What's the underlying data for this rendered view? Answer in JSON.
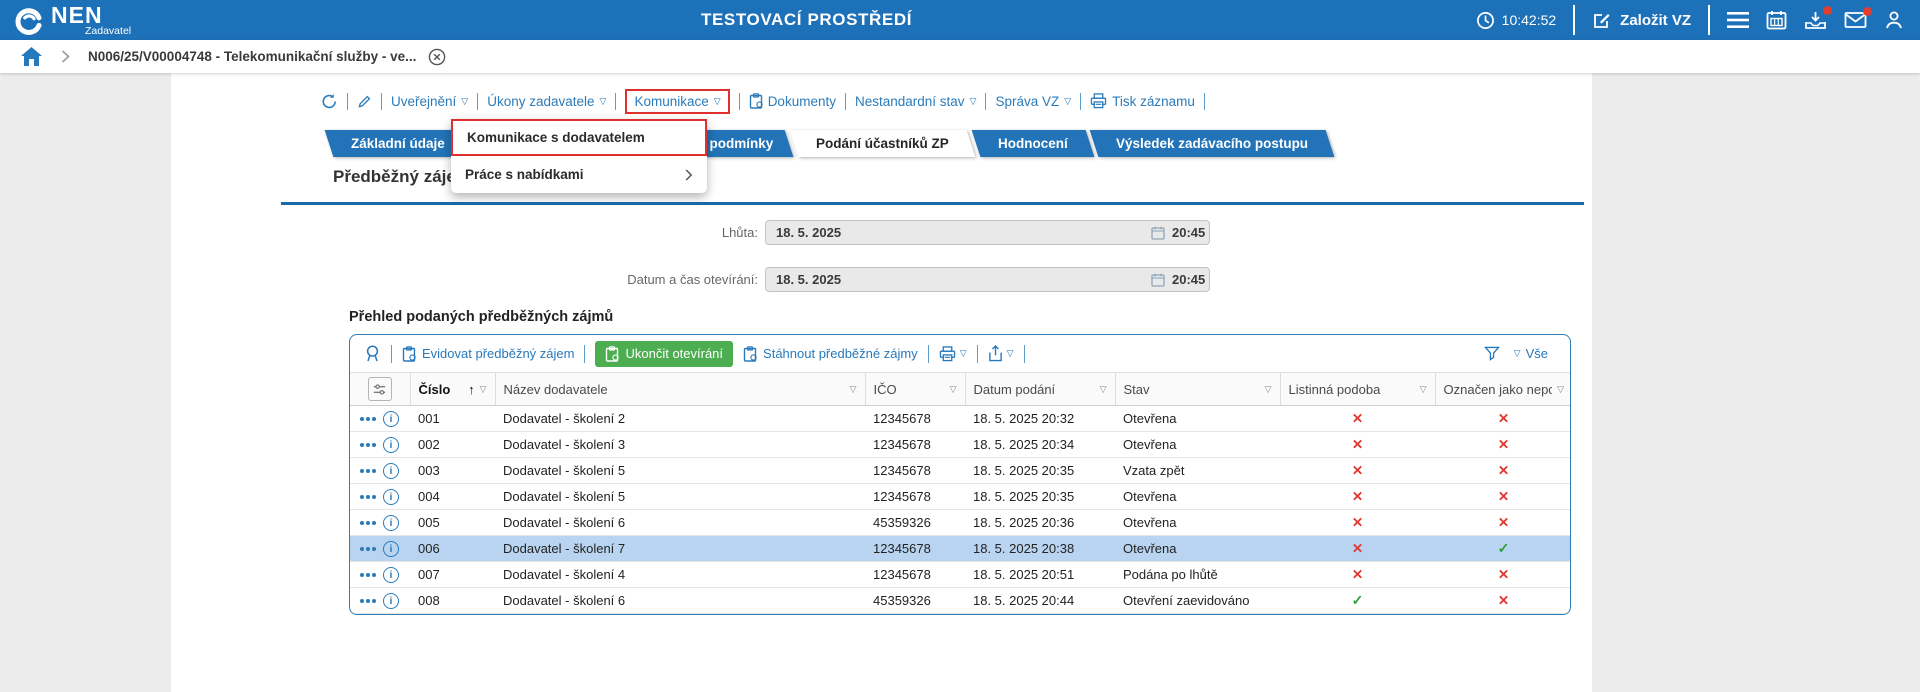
{
  "colors": {
    "header_blue": "#1d71b8",
    "link_blue": "#2779bd",
    "tab_blue": "#2273b8",
    "green": "#4cae50",
    "red_mark": "#e03a34",
    "green_mark": "#2f9e3f",
    "highlight_red": "#e0302e",
    "selected_row": "#b8d4f0"
  },
  "icons": {
    "caret_down": "▽",
    "sort_asc": "↑",
    "cross": "✕",
    "check": "✓"
  },
  "header": {
    "logo_title": "NEN",
    "logo_subtitle": "Zadavatel",
    "env_title": "TESTOVACÍ PROSTŘEDÍ",
    "time": "10:42:52",
    "create_vz_label": "Založit VZ"
  },
  "breadcrumb": {
    "item": "N006/25/V00004748 - Telekomunikační služby - ve..."
  },
  "record_toolbar": {
    "items": [
      {
        "label": "Uveřejnění",
        "caret": true,
        "icon": null,
        "highlighted": false
      },
      {
        "label": "Úkony zadavatele",
        "caret": true,
        "icon": null,
        "highlighted": false
      },
      {
        "label": "Komunikace",
        "caret": true,
        "icon": null,
        "highlighted": true
      },
      {
        "label": "Dokumenty",
        "caret": false,
        "icon": "clipboard",
        "highlighted": false
      },
      {
        "label": "Nestandardní stav",
        "caret": true,
        "icon": null,
        "highlighted": false
      },
      {
        "label": "Správa VZ",
        "caret": true,
        "icon": null,
        "highlighted": false
      },
      {
        "label": "Tisk záznamu",
        "caret": false,
        "icon": "printer",
        "highlighted": false
      }
    ]
  },
  "dropdown_menu": {
    "items": [
      {
        "label": "Komunikace s dodavatelem",
        "highlighted": true,
        "submenu": false
      },
      {
        "label": "Práce s nabídkami",
        "highlighted": false,
        "submenu": true
      }
    ]
  },
  "tabs": [
    {
      "label": "Základní údaje",
      "active": false,
      "wide": false
    },
    {
      "label": "Zadávací podmínky",
      "active": false,
      "wide": true
    },
    {
      "label": "Podání účastníků ZP",
      "active": true,
      "wide": false
    },
    {
      "label": "Hodnocení",
      "active": false,
      "wide": false
    },
    {
      "label": "Výsledek zadávacího postupu",
      "active": false,
      "wide": false
    }
  ],
  "page": {
    "title": "Předběžný zájem",
    "fields": [
      {
        "label": "Lhůta:",
        "date": "18. 5. 2025",
        "time": "20:45"
      },
      {
        "label": "Datum a čas otevírání:",
        "date": "18. 5. 2025",
        "time": "20:45"
      }
    ],
    "table_heading": "Přehled podaných předběžných zájmů"
  },
  "table_toolbar": {
    "buttons": [
      {
        "label": "Evidovat předběžný zájem",
        "style": "link"
      },
      {
        "label": "Ukončit otevírání",
        "style": "primary"
      },
      {
        "label": "Stáhnout předběžné zájmy",
        "style": "link"
      }
    ],
    "filter_all": "Vše"
  },
  "table": {
    "columns": [
      {
        "key": "cislo",
        "label": "Číslo",
        "sorted": true
      },
      {
        "key": "nazev",
        "label": "Název dodavatele",
        "sorted": false
      },
      {
        "key": "ico",
        "label": "IČO",
        "sorted": false
      },
      {
        "key": "datum",
        "label": "Datum podání",
        "sorted": false
      },
      {
        "key": "stav",
        "label": "Stav",
        "sorted": false
      },
      {
        "key": "listinna",
        "label": "Listinná podoba",
        "sorted": false
      },
      {
        "key": "nepodany",
        "label": "Označen jako nepodaný",
        "sorted": false
      }
    ],
    "rows": [
      {
        "cislo": "001",
        "nazev": "Dodavatel - školení 2",
        "ico": "12345678",
        "datum": "18. 5. 2025 20:32",
        "stav": "Otevřena",
        "listinna": false,
        "nepodany": false,
        "selected": false
      },
      {
        "cislo": "002",
        "nazev": "Dodavatel - školení 3",
        "ico": "12345678",
        "datum": "18. 5. 2025 20:34",
        "stav": "Otevřena",
        "listinna": false,
        "nepodany": false,
        "selected": false
      },
      {
        "cislo": "003",
        "nazev": "Dodavatel - školení 5",
        "ico": "12345678",
        "datum": "18. 5. 2025 20:35",
        "stav": "Vzata zpět",
        "listinna": false,
        "nepodany": false,
        "selected": false
      },
      {
        "cislo": "004",
        "nazev": "Dodavatel - školení 5",
        "ico": "12345678",
        "datum": "18. 5. 2025 20:35",
        "stav": "Otevřena",
        "listinna": false,
        "nepodany": false,
        "selected": false
      },
      {
        "cislo": "005",
        "nazev": "Dodavatel - školení 6",
        "ico": "45359326",
        "datum": "18. 5. 2025 20:36",
        "stav": "Otevřena",
        "listinna": false,
        "nepodany": false,
        "selected": false
      },
      {
        "cislo": "006",
        "nazev": "Dodavatel - školení 7",
        "ico": "12345678",
        "datum": "18. 5. 2025 20:38",
        "stav": "Otevřena",
        "listinna": false,
        "nepodany": true,
        "selected": true
      },
      {
        "cislo": "007",
        "nazev": "Dodavatel - školení 4",
        "ico": "12345678",
        "datum": "18. 5. 2025 20:51",
        "stav": "Podána po lhůtě",
        "listinna": false,
        "nepodany": false,
        "selected": false
      },
      {
        "cislo": "008",
        "nazev": "Dodavatel - školení 6",
        "ico": "45359326",
        "datum": "18. 5. 2025 20:44",
        "stav": "Otevření zaevidováno",
        "listinna": true,
        "nepodany": false,
        "selected": false
      }
    ]
  }
}
